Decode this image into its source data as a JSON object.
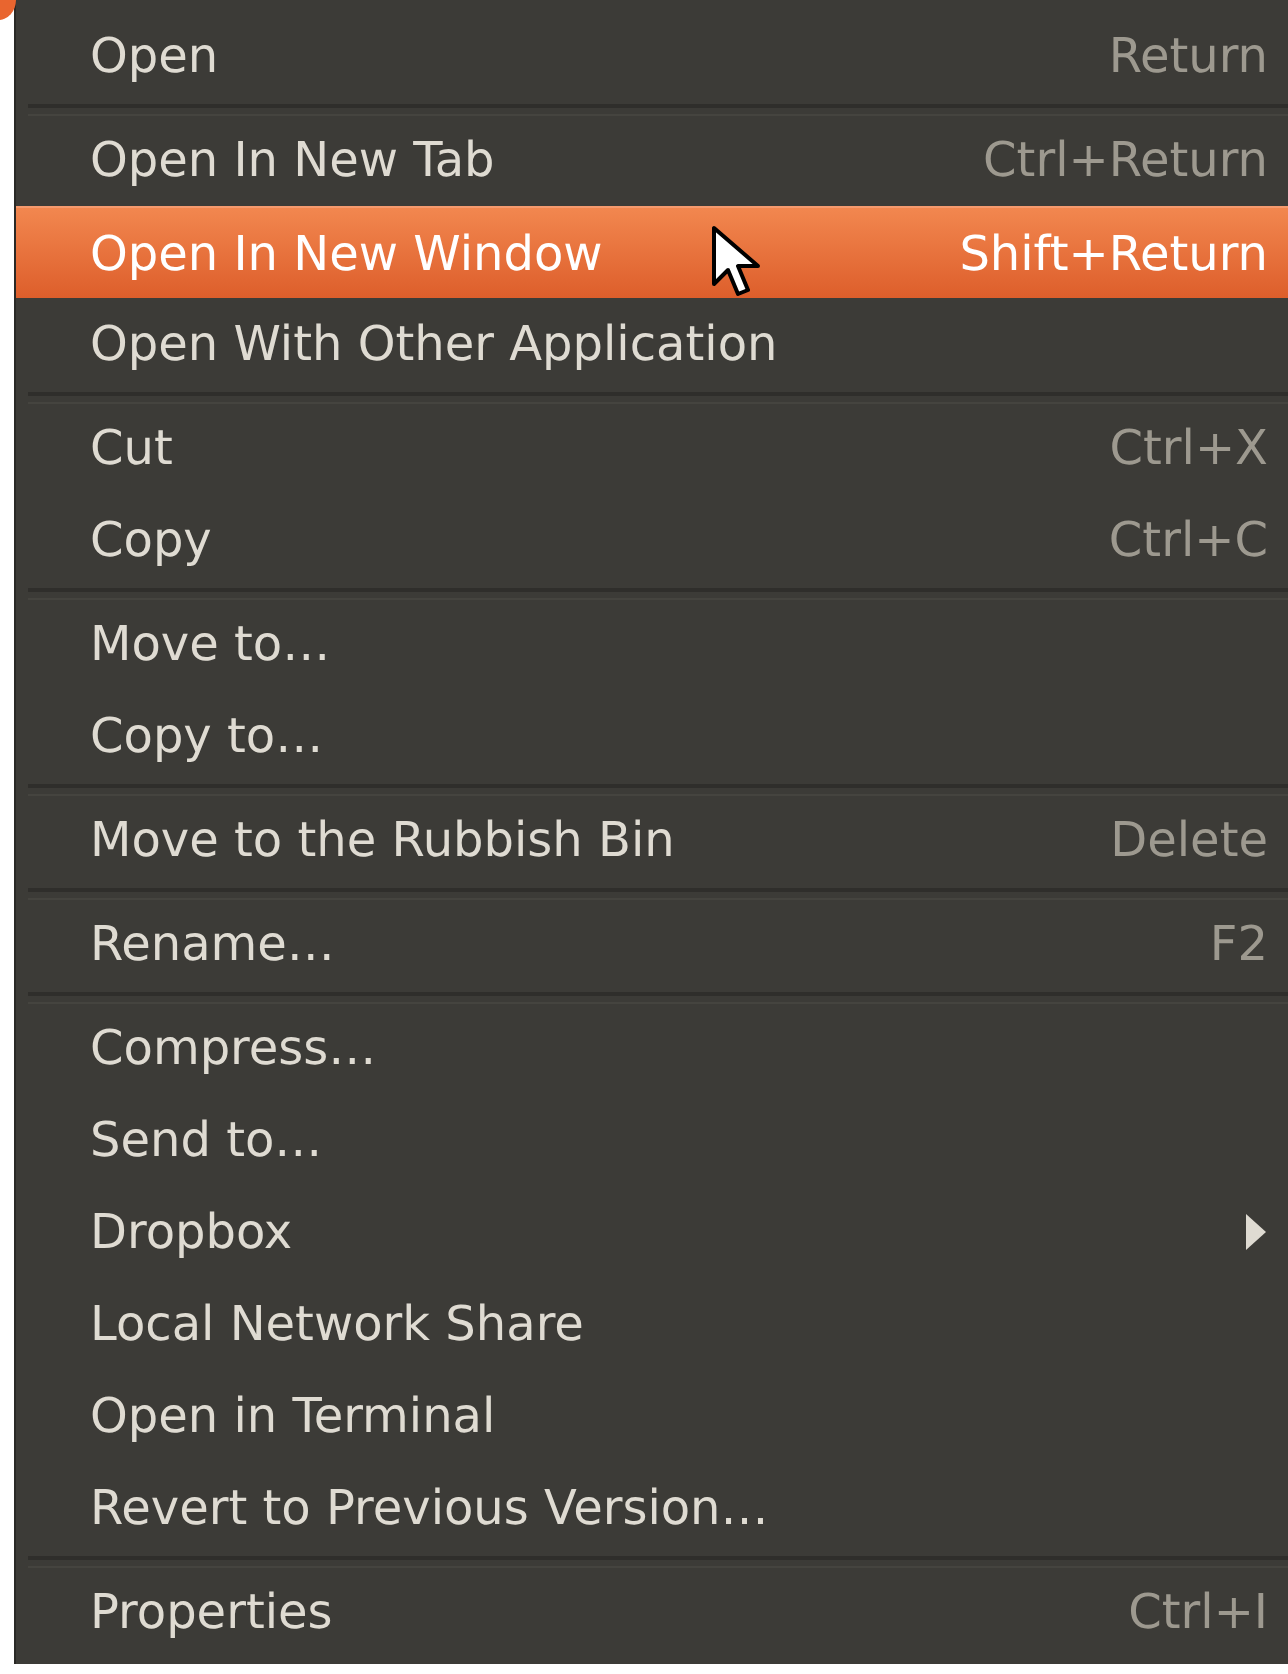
{
  "menu": {
    "groups": [
      {
        "items": [
          {
            "label": "Open",
            "shortcut": "Return",
            "selected": false,
            "has_submenu": false
          }
        ]
      },
      {
        "items": [
          {
            "label": "Open In New Tab",
            "shortcut": "Ctrl+Return",
            "selected": false,
            "has_submenu": false
          },
          {
            "label": "Open In New Window",
            "shortcut": "Shift+Return",
            "selected": true,
            "has_submenu": false
          },
          {
            "label": "Open With Other Application",
            "selected": false,
            "has_submenu": false
          }
        ]
      },
      {
        "items": [
          {
            "label": "Cut",
            "shortcut": "Ctrl+X",
            "selected": false,
            "has_submenu": false
          },
          {
            "label": "Copy",
            "shortcut": "Ctrl+C",
            "selected": false,
            "has_submenu": false
          }
        ]
      },
      {
        "items": [
          {
            "label": "Move to…",
            "selected": false,
            "has_submenu": false
          },
          {
            "label": "Copy to…",
            "selected": false,
            "has_submenu": false
          }
        ]
      },
      {
        "items": [
          {
            "label": "Move to the Rubbish Bin",
            "shortcut": "Delete",
            "selected": false,
            "has_submenu": false
          }
        ]
      },
      {
        "items": [
          {
            "label": "Rename…",
            "shortcut": "F2",
            "selected": false,
            "has_submenu": false
          }
        ]
      },
      {
        "items": [
          {
            "label": "Compress…",
            "selected": false,
            "has_submenu": false
          },
          {
            "label": "Send to…",
            "selected": false,
            "has_submenu": false
          },
          {
            "label": "Dropbox",
            "selected": false,
            "has_submenu": true
          },
          {
            "label": "Local Network Share",
            "selected": false,
            "has_submenu": false
          },
          {
            "label": "Open in Terminal",
            "selected": false,
            "has_submenu": false
          },
          {
            "label": "Revert to Previous Version…",
            "selected": false,
            "has_submenu": false
          }
        ]
      },
      {
        "items": [
          {
            "label": "Properties",
            "shortcut": "Ctrl+I",
            "selected": false,
            "has_submenu": false
          }
        ]
      }
    ]
  }
}
